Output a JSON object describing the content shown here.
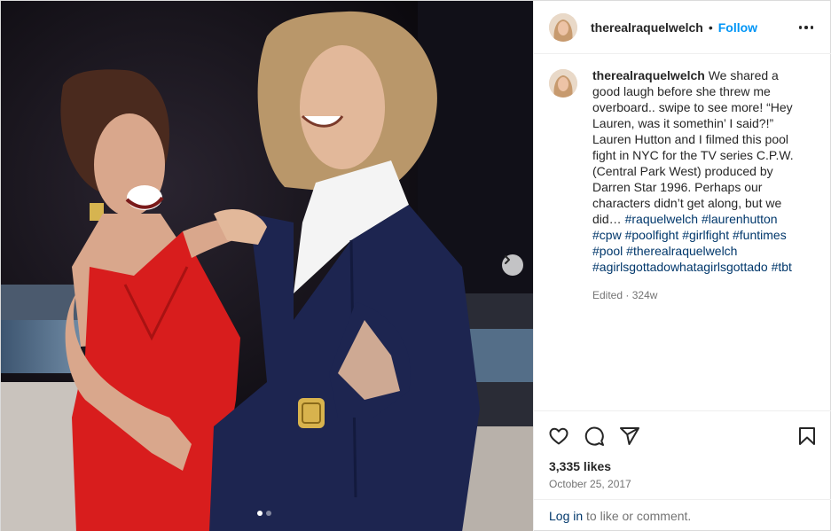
{
  "post": {
    "username": "therealraquelwelch",
    "follow_label": "Follow",
    "separator": "•",
    "caption_text": " We shared a good laugh before she threw me overboard.. swipe to see more! “Hey Lauren, was it somethin’ I said?!” Lauren Hutton and I filmed this pool fight in NYC for the TV series C.P.W. (Central Park West) produced by Darren Star 1996. Perhaps our characters didn’t get along, but we did… ",
    "hashtags": [
      "#raquelwelch",
      "#laurenhutton",
      "#cpw",
      "#poolfight",
      "#girlfight",
      "#funtimes",
      "#pool",
      "#therealraquelwelch",
      "#agirlsgottadowhatagirlsgottado",
      "#tbt"
    ],
    "edited_label": "Edited",
    "meta_separator": "·",
    "age": "324w",
    "likes": "3,335 likes",
    "date": "October 25, 2017",
    "login_link": "Log in",
    "login_rest": " to like or comment."
  },
  "carousel": {
    "slide_count": 2,
    "active_slide": 1
  },
  "icons": {
    "like": "heart-icon",
    "comment": "comment-icon",
    "share": "share-icon",
    "save": "bookmark-icon",
    "more": "more-options-icon",
    "next": "chevron-right-icon"
  },
  "colors": {
    "accent": "#0095f6",
    "hashtag": "#00376b",
    "secondary_text": "#737373",
    "primary_text": "#262626",
    "dress_red": "#d81d1d",
    "suit_navy": "#1d2550"
  }
}
